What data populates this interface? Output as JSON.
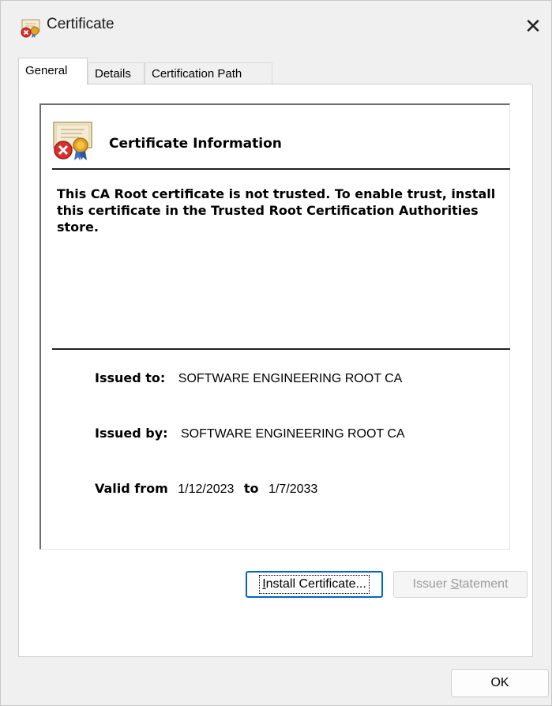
{
  "window": {
    "title": "Certificate",
    "close_glyph": "✕"
  },
  "tabs": [
    {
      "label": "General",
      "active": true
    },
    {
      "label": "Details",
      "active": false
    },
    {
      "label": "Certification Path",
      "active": false
    }
  ],
  "info": {
    "heading": "Certificate Information",
    "warning": "This CA Root certificate is not trusted. To enable trust, install this certificate in the Trusted Root Certification Authorities store.",
    "issued_to_label": "Issued to:",
    "issued_to_value": "SOFTWARE ENGINEERING ROOT CA",
    "issued_by_label": "Issued by:",
    "issued_by_value": "SOFTWARE ENGINEERING ROOT CA",
    "valid_from_label": "Valid from",
    "valid_from_value": "1/12/2023",
    "to_word": "to",
    "valid_to_value": "1/7/2033"
  },
  "buttons": {
    "install_prefix": "I",
    "install_rest": "nstall Certificate...",
    "issuer_prefix": "Issuer ",
    "issuer_accel": "S",
    "issuer_rest": "tatement",
    "ok": "OK"
  },
  "icons": {
    "title": "certificate-error-icon",
    "info": "certificate-error-icon",
    "close": "close-icon"
  },
  "colors": {
    "accent": "#0067c0",
    "error_red": "#d9302c",
    "ribbon_gold": "#e0a323"
  }
}
